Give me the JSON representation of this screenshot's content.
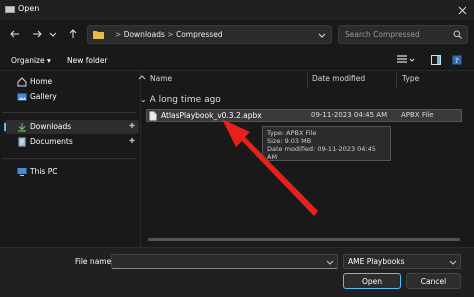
{
  "window": {
    "title": "Open"
  },
  "address": {
    "path": [
      "Downloads",
      "Compressed"
    ],
    "separator": ">"
  },
  "search": {
    "placeholder": "Search Compressed"
  },
  "toolbar": {
    "organize_label": "Organize",
    "new_folder_label": "New folder"
  },
  "sidebar": {
    "items": [
      {
        "label": "Home",
        "icon": "home-icon"
      },
      {
        "label": "Gallery",
        "icon": "gallery-icon"
      },
      {
        "label": "Downloads",
        "icon": "download-icon",
        "pinned": true,
        "selected": true
      },
      {
        "label": "Documents",
        "icon": "document-icon",
        "pinned": true
      },
      {
        "label": "This PC",
        "icon": "computer-icon"
      }
    ]
  },
  "columns": {
    "name": "Name",
    "date_modified": "Date modified",
    "type": "Type"
  },
  "group": {
    "label": "A long time ago"
  },
  "files": [
    {
      "name": "AtlasPlaybook_v0.3.2.apbx",
      "date": "09-11-2023 04:45 AM",
      "type": "APBX File"
    }
  ],
  "tooltip": {
    "type_line": "Type: APBX File",
    "size_line": "Size: 9.03 MB",
    "date_line": "Date modified: 09-11-2023 04:45 AM"
  },
  "footer": {
    "file_name_label": "File name:",
    "file_name_value": "",
    "file_type_value": "AME Playbooks",
    "open_label": "Open",
    "cancel_label": "Cancel"
  },
  "colors": {
    "annotation_arrow": "#e8201c",
    "accent": "#4cc2ff"
  }
}
